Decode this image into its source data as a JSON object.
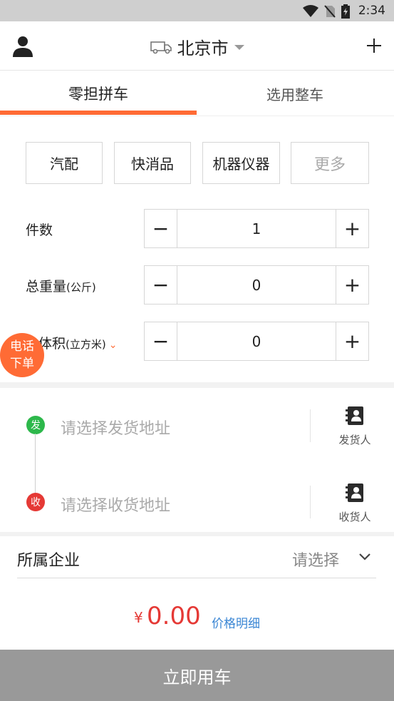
{
  "status_bar": {
    "time": "2:34",
    "icons": [
      "wifi-icon",
      "no-sim-icon",
      "battery-charging-icon"
    ]
  },
  "header": {
    "city": "北京市",
    "icons": [
      "user-icon",
      "truck-icon",
      "caret-down-icon",
      "plus-icon"
    ]
  },
  "tabs": [
    {
      "label": "零担拼车",
      "active": true
    },
    {
      "label": "选用整车",
      "active": false
    }
  ],
  "categories": [
    "汽配",
    "快消品",
    "机器仪器",
    "更多"
  ],
  "fields": {
    "pieces": {
      "label": "件数",
      "value": "1"
    },
    "weight": {
      "label": "总重量",
      "unit": "(公斤)",
      "value": "0"
    },
    "volume": {
      "label": "体积",
      "unit": "(立方米)",
      "value": "0"
    },
    "minus": "−",
    "plus": "+"
  },
  "float_button": {
    "line1": "电话",
    "line2": "下单"
  },
  "addresses": {
    "sender": {
      "badge": "发",
      "placeholder": "请选择发货地址",
      "contact_label": "发货人"
    },
    "receiver": {
      "badge": "收",
      "placeholder": "请选择收货地址",
      "contact_label": "收货人"
    }
  },
  "company": {
    "label": "所属企业",
    "value": "请选择"
  },
  "price": {
    "currency": "¥",
    "amount": "0.00",
    "detail_link": "价格明细"
  },
  "submit": {
    "label": "立即用车"
  },
  "colors": {
    "accent": "#ff6b35",
    "sender_badge": "#2db84b",
    "receiver_badge": "#e53935",
    "price": "#e53935",
    "link": "#3a86d4",
    "submit_bg": "#999999"
  }
}
